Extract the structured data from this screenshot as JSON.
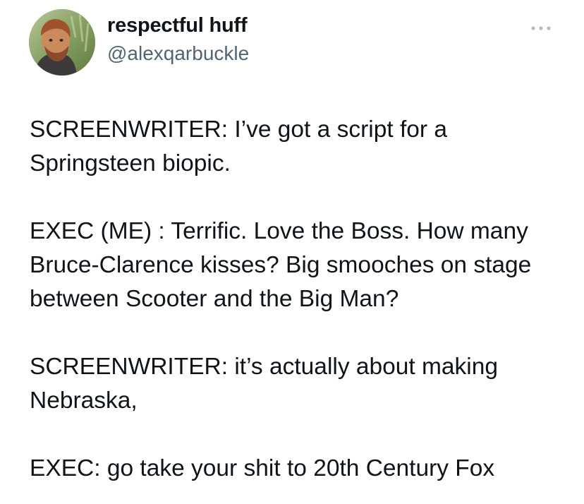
{
  "tweet": {
    "author": {
      "display_name": "respectful huff",
      "handle": "@alexqarbuckle",
      "avatar_icon": "user-avatar-photo"
    },
    "more_icon": "more-options-icon",
    "paragraphs": [
      "SCREENWRITER: I’ve got a script for a Springsteen biopic.",
      "EXEC (ME) : Terrific. Love the Boss. How many Bruce-Clarence kisses? Big smooches on stage between Scooter and the Big Man?",
      "SCREENWRITER: it’s actually about making Nebraska,",
      "EXEC: go take your shit to 20th Century Fox"
    ]
  },
  "colors": {
    "text": "#0f1419",
    "secondary_text": "#536471",
    "background": "#ffffff"
  }
}
